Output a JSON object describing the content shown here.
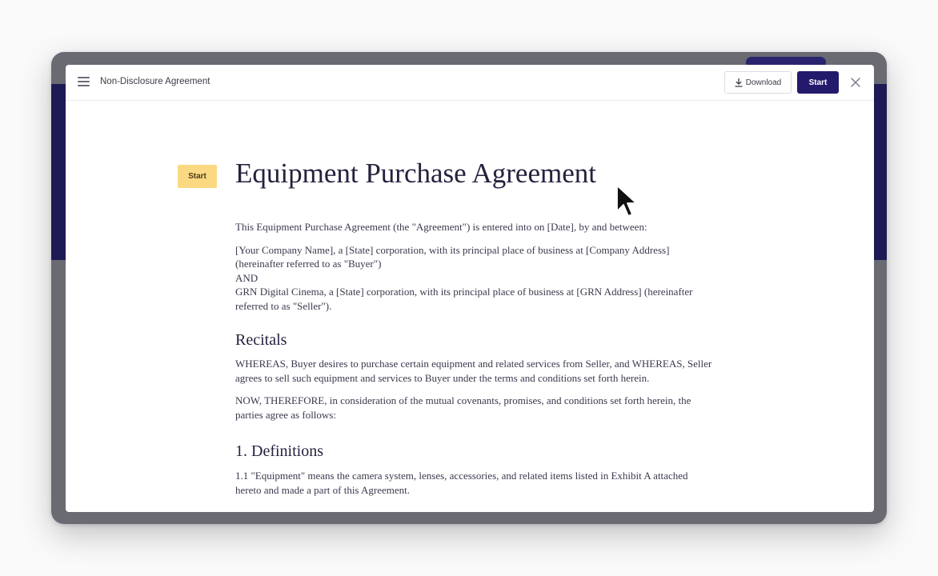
{
  "header": {
    "title": "Non-Disclosure Agreement",
    "download_label": "Download",
    "start_label": "Start"
  },
  "side": {
    "start_tag": "Start"
  },
  "document": {
    "title": "Equipment Purchase Agreement",
    "intro": "This Equipment Purchase Agreement (the \"Agreement\") is entered into on [Date], by and between:",
    "party_1": "[Your Company Name], a [State] corporation, with its principal place of business at [Company Address] (hereinafter referred to as \"Buyer\")",
    "and": "AND",
    "party_2": "GRN Digital Cinema, a [State] corporation, with its principal place of business at [GRN Address] (hereinafter referred to as \"Seller\").",
    "recitals_heading": "Recitals",
    "recital_1": "WHEREAS, Buyer desires to purchase certain equipment and related services from Seller, and WHEREAS, Seller agrees to sell such equipment and services to Buyer under the terms and conditions set forth herein.",
    "recital_2": "NOW, THEREFORE, in consideration of the mutual covenants, promises, and conditions set forth herein, the parties agree as follows:",
    "definitions_heading": "1. Definitions",
    "definition_1_1": "1.1 \"Equipment\" means the camera system, lenses, accessories, and related items listed in Exhibit A attached hereto and made a part of this Agreement."
  },
  "colors": {
    "primary": "#231a6b",
    "start_tag": "#fbd982",
    "frame": "#6a6a73"
  },
  "icons": [
    "menu-icon",
    "download-icon",
    "close-icon",
    "mouse-cursor-icon"
  ]
}
